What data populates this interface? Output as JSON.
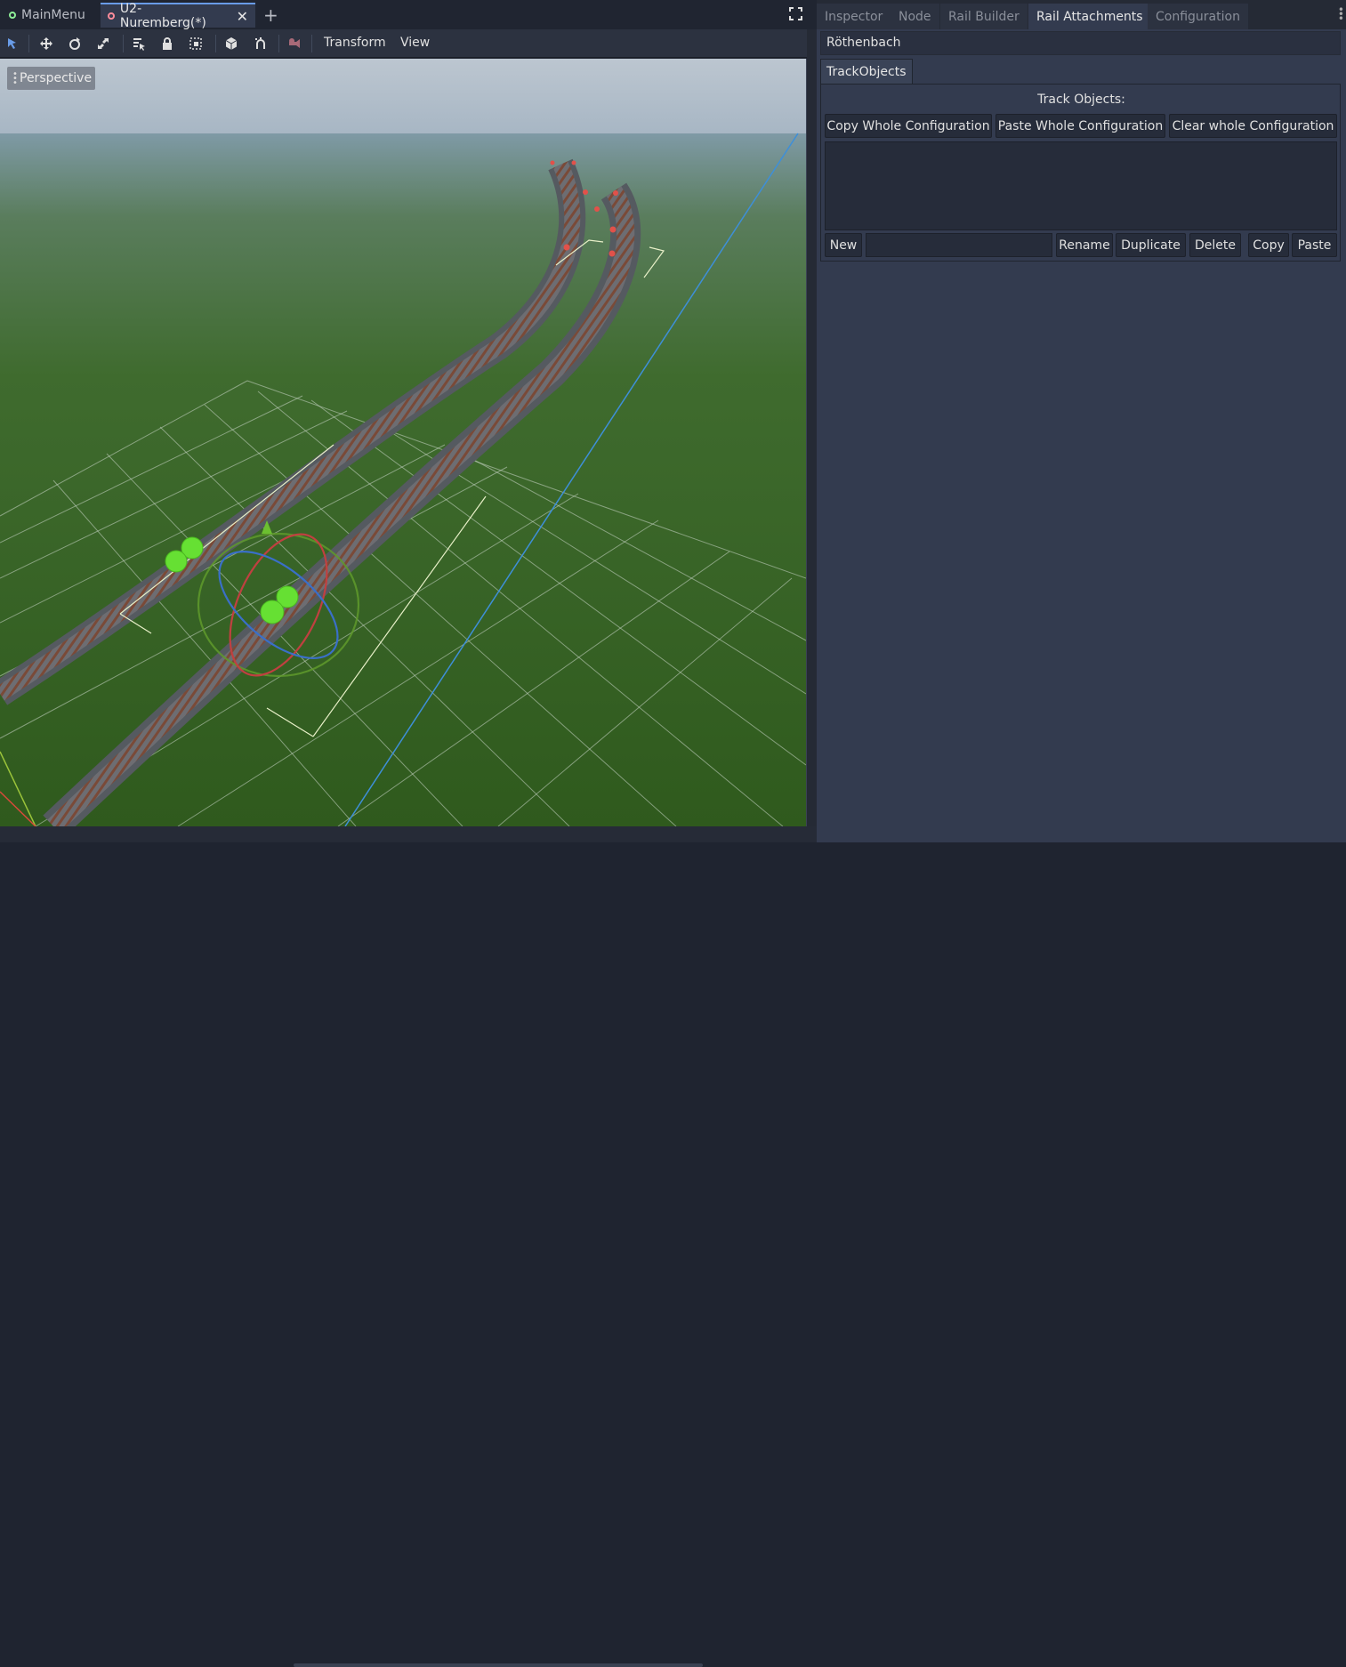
{
  "scene_tabs": [
    {
      "label": "MainMenu",
      "active": false
    },
    {
      "label": "U2-Nuremberg(*)",
      "active": true
    }
  ],
  "toolbar": {
    "tools": [
      "select-icon",
      "move-icon",
      "rotate-icon",
      "scale-icon",
      "list-select-icon",
      "lock-icon",
      "group-icon",
      "local-space-icon",
      "snap-icon",
      "camera-icon"
    ],
    "menu_transform": "Transform",
    "menu_view": "View"
  },
  "viewport": {
    "mode_label": "Perspective"
  },
  "dock": {
    "tabs": [
      {
        "label": "Inspector",
        "active": false
      },
      {
        "label": "Node",
        "active": false
      },
      {
        "label": "Rail Builder",
        "active": false
      },
      {
        "label": "Rail Attachments",
        "active": true
      },
      {
        "label": "Configuration",
        "active": false
      }
    ],
    "node_name": "Röthenbach",
    "sub_tab": "TrackObjects",
    "section_title": "Track Objects:",
    "config_buttons": {
      "copy": "Copy Whole Configuration",
      "paste": "Paste Whole Configuration",
      "clear": "Clear whole Configuration"
    },
    "object_name_value": "",
    "list_buttons": {
      "new": "New",
      "rename": "Rename",
      "duplicate": "Duplicate",
      "delete": "Delete",
      "copy": "Copy",
      "paste": "Paste"
    }
  },
  "colors": {
    "accent": "#699ce8",
    "background": "#333b4f",
    "editor_dark": "#202531"
  }
}
